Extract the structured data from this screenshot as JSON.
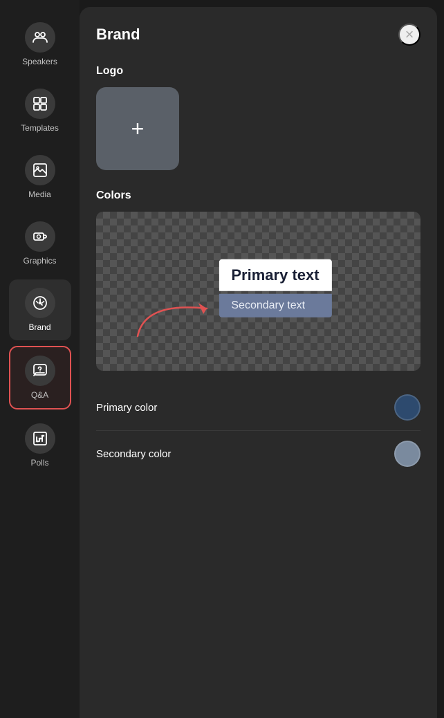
{
  "sidebar": {
    "items": [
      {
        "id": "speakers",
        "label": "Speakers",
        "active": false
      },
      {
        "id": "templates",
        "label": "Templates",
        "active": false
      },
      {
        "id": "media",
        "label": "Media",
        "active": false
      },
      {
        "id": "graphics",
        "label": "Graphics",
        "active": false
      },
      {
        "id": "brand",
        "label": "Brand",
        "active": true
      },
      {
        "id": "qa",
        "label": "Q&A",
        "active": false,
        "selected": true
      },
      {
        "id": "polls",
        "label": "Polls",
        "active": false
      }
    ]
  },
  "panel": {
    "title": "Brand",
    "close_label": "×",
    "logo_section": "Logo",
    "logo_plus": "+",
    "colors_section": "Colors",
    "primary_text": "Primary text",
    "secondary_text": "Secondary text",
    "primary_color_label": "Primary color",
    "secondary_color_label": "Secondary color"
  },
  "colors": {
    "primary": "#2d4a6e",
    "secondary": "#7a8a9e"
  }
}
